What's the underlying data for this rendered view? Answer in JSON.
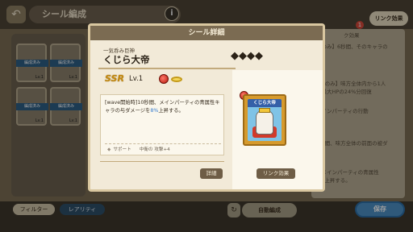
{
  "header": {
    "title": "シール編成",
    "info_label": "i",
    "back_label": "↶",
    "link_effect_label": "リンク効果",
    "badge_count": "1"
  },
  "left_cards": [
    {
      "label": "編成済み",
      "level": "Lv.1"
    },
    {
      "label": "編成済み",
      "level": "Lv.1"
    },
    {
      "label": "編成済み",
      "level": "Lv.1"
    },
    {
      "label": "編成済み",
      "level": "Lv.1"
    }
  ],
  "right_panel": {
    "lines": [
      "ク効果",
      "度のみ】6秒間、そのキャラの",
      "",
      "1度のみ】味方全体内から1人",
      "の最大HPの24%分回復",
      "",
      "メインパーティの行動",
      "",
      "5秒間、味方全体の前面の被ダ",
      "",
      "、メインパーティの青属性",
      "8%上昇する。"
    ]
  },
  "bottom": {
    "filter_label": "フィルター",
    "rarity_label": "レアリティ",
    "auto_label": "自動編成",
    "reload_label": "↻",
    "save_label": "保存"
  },
  "modal": {
    "title": "シール詳細",
    "subtitle": "一気呑み巨神",
    "name": "くじら大帝",
    "stars": "◆◆◆◆",
    "rarity": "SSR",
    "level": "Lv.1",
    "description_part1": "[wave開始時]10秒間、メインパーティの青属性キャラの与ダメージを",
    "description_highlight": "8%",
    "description_part2": "上昇する。",
    "support_label": "サポート",
    "support_value": "中衛の 攻撃+4",
    "detail_button": "詳細",
    "link_button": "リンク効果",
    "card_title": "くじら大帝"
  },
  "colors": {
    "header_brown": "#7b6b52",
    "modal_bg": "#f2ead8",
    "highlight_blue": "#3a7fd0",
    "save_blue": "#4c90c6",
    "ssr_gold": "#c48a12"
  }
}
